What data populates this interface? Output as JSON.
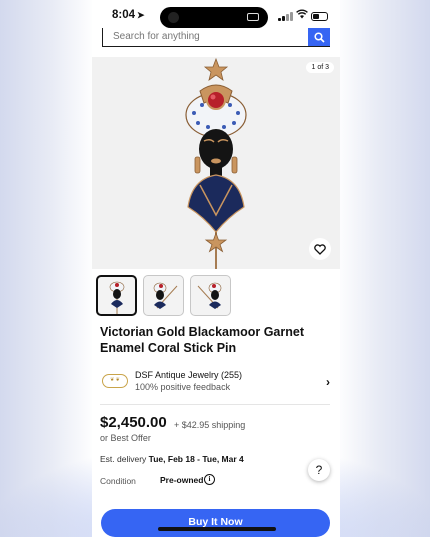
{
  "status_bar": {
    "time": "8:04"
  },
  "search": {
    "placeholder": "Search for anything"
  },
  "gallery": {
    "counter": "1 of 3",
    "thumbnail_count": 3
  },
  "listing": {
    "title": "Victorian Gold Blackamoor Garnet Enamel Coral Stick Pin",
    "price": "$2,450.00",
    "shipping": "+ $42.95 shipping",
    "best_offer": "or Best Offer",
    "delivery_label": "Est. delivery",
    "delivery_value": "Tue, Feb 18 - Tue, Mar 4",
    "condition_label": "Condition",
    "condition_value": "Pre-owned"
  },
  "seller": {
    "name": "DSF Antique Jewelry (255)",
    "feedback": "100% positive feedback"
  },
  "actions": {
    "buy_now": "Buy It Now"
  },
  "colors": {
    "accent": "#3665f3",
    "text": "#111111"
  }
}
